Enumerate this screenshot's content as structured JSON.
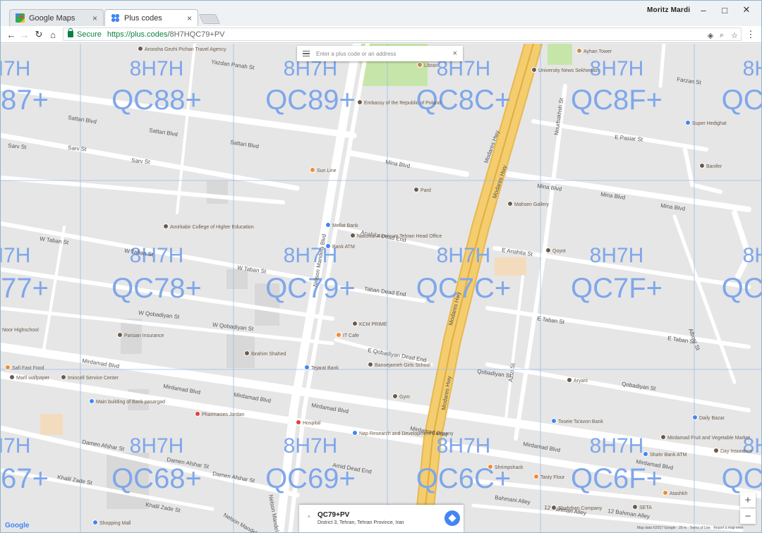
{
  "browser": {
    "tabs": [
      {
        "title": "Google Maps",
        "close": "×"
      },
      {
        "title": "Plus codes",
        "close": "×"
      }
    ],
    "user": "Moritz Mardi",
    "window_controls": {
      "minimize": "–",
      "maximize": "□",
      "close": "✕"
    },
    "nav": {
      "back": "←",
      "forward": "→",
      "reload": "↻",
      "home": "⌂"
    },
    "secure_label": "Secure",
    "url_host": "https://plus.codes/",
    "url_path": "8H7HQC79+PV",
    "menu_icon": "⋮"
  },
  "search": {
    "placeholder": "Enter a plus code or an address",
    "clear": "×"
  },
  "plus_code_grid": {
    "area_prefix": "8H7H",
    "cells": [
      {
        "row": 0,
        "col": 0,
        "code": "QC87+"
      },
      {
        "row": 0,
        "col": 1,
        "code": "QC88+"
      },
      {
        "row": 0,
        "col": 2,
        "code": "QC89+"
      },
      {
        "row": 0,
        "col": 3,
        "code": "QC8C+"
      },
      {
        "row": 0,
        "col": 4,
        "code": "QC8F+"
      },
      {
        "row": 0,
        "col": 5,
        "code": "QC8G+"
      },
      {
        "row": 1,
        "col": 0,
        "code": "QC77+"
      },
      {
        "row": 1,
        "col": 1,
        "code": "QC78+"
      },
      {
        "row": 1,
        "col": 2,
        "code": "QC79+"
      },
      {
        "row": 1,
        "col": 3,
        "code": "QC7C+"
      },
      {
        "row": 1,
        "col": 4,
        "code": "QC7F+"
      },
      {
        "row": 1,
        "col": 5,
        "code": "QC7G+"
      },
      {
        "row": 2,
        "col": 0,
        "code": "QC67+"
      },
      {
        "row": 2,
        "col": 1,
        "code": "QC68+"
      },
      {
        "row": 2,
        "col": 2,
        "code": "QC69+"
      },
      {
        "row": 2,
        "col": 3,
        "code": "QC6C+"
      },
      {
        "row": 2,
        "col": 4,
        "code": "QC6F+"
      },
      {
        "row": 2,
        "col": 5,
        "code": "QC6G+"
      }
    ]
  },
  "streets": [
    "Yazdan Panah St",
    "Sattari Blvd",
    "Sattari Blvd",
    "Sattari Blvd",
    "Sarv St",
    "Sarv St",
    "Sarv St",
    "Mina Blvd",
    "Mina Blvd",
    "Mina Blvd",
    "Mina Blvd",
    "W Taban St",
    "W Taban St",
    "W Taban St",
    "Taban Dead End",
    "Anahita Dead End",
    "E Anahita St",
    "W Qobadiyan St",
    "W Qobadiyan St",
    "E Taban St",
    "E Taban St",
    "E Qobadiyan Dead End",
    "Qobadiyan St",
    "Qobadiyan St",
    "Mirdamad Blvd",
    "Mirdamad Blvd",
    "Mirdamad Blvd",
    "Mirdamad Blvd",
    "Mirdamad Blvd",
    "Mirdamad Blvd",
    "Mirdamad Blvd",
    "Damen Afshar St",
    "Damen Afshar St",
    "Damen Afshar St",
    "Amid Dead End",
    "Khalil Zade St",
    "Khalil Zade St",
    "Bahmani Alley",
    "12 Bahman Alley",
    "12 Bahman Alley",
    "Modares Hwy",
    "Modares Hwy",
    "Modares Hwy",
    "Modares Hwy",
    "Nelson Mandela Blvd",
    "Nelson Mandela Blvd",
    "Nelson Mandela Blvd",
    "Farzan St",
    "E Pasiar St",
    "Nourbakhsh St",
    "Azizi St",
    "Alborz St"
  ],
  "pois": [
    "Aroosha Gezhi Pichan Travel Agency",
    "Libran",
    "Ayhan Tower",
    "University News Sekheman",
    "Embassy of the Republic of Poland",
    "Super Hedighat",
    "Sun Line",
    "Banifer",
    "Pard",
    "Mahsen Gallery",
    "Amirkabir College of Higher Education",
    "Mellat Bank",
    "National Aluminum Tehran Head Office",
    "Bank ATM",
    "Qoyot",
    "KCM PRIME",
    "IT Cafe",
    "Noor Highschool",
    "Parsian Insurance",
    "Ibrahim Shahed",
    "Tejarat Bank",
    "Banoejameh Girls School",
    "Safi Fast Food",
    "Marll wallpaper",
    "Imincell Service Center",
    "Main building of Bank pasargad",
    "Pharmacies Jordan",
    "Hospital",
    "Nap Research and Development Company",
    "Gym",
    "Aryani",
    "Toseie Ta'avon Bank",
    "Daily Bazar",
    "Mirdamad Fruit and Vegetable Market",
    "Shahr Bank ATM",
    "Day Insurance",
    "Shrimpshack",
    "Tasty Flour",
    "Shahrban Company",
    "Atashkh",
    "Shopping Mall",
    "SETA"
  ],
  "info_card": {
    "code": "QC79+PV",
    "address": "District 3, Tehran, Tehran Province, Iran",
    "chevron": "^"
  },
  "zoom": {
    "in": "+",
    "out": "−"
  },
  "google_logo": "Google",
  "attribution": "Map data ©2017 Google · 20 m · Terms of Use · Report a map error",
  "colors": {
    "highway": "#f4cd6e",
    "road": "#ffffff",
    "grid_line": "#9db9ee",
    "plus_code_text": "#7fa7ea",
    "park": "#c6e6a9",
    "secure_green": "#0b8043"
  }
}
